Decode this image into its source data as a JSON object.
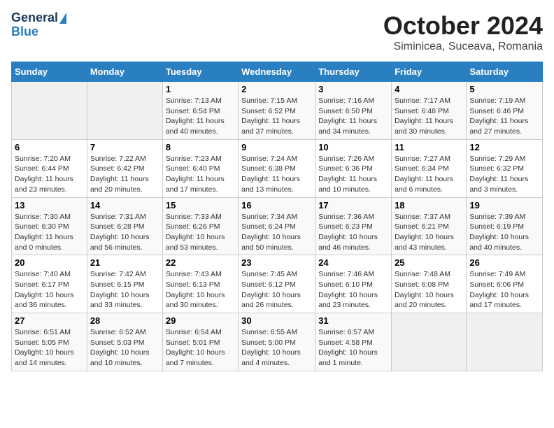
{
  "header": {
    "logo_general": "General",
    "logo_blue": "Blue",
    "month_title": "October 2024",
    "location": "Siminicea, Suceava, Romania"
  },
  "calendar": {
    "days_of_week": [
      "Sunday",
      "Monday",
      "Tuesday",
      "Wednesday",
      "Thursday",
      "Friday",
      "Saturday"
    ],
    "weeks": [
      [
        {
          "day": "",
          "info": ""
        },
        {
          "day": "",
          "info": ""
        },
        {
          "day": "1",
          "info": "Sunrise: 7:13 AM\nSunset: 6:54 PM\nDaylight: 11 hours and 40 minutes."
        },
        {
          "day": "2",
          "info": "Sunrise: 7:15 AM\nSunset: 6:52 PM\nDaylight: 11 hours and 37 minutes."
        },
        {
          "day": "3",
          "info": "Sunrise: 7:16 AM\nSunset: 6:50 PM\nDaylight: 11 hours and 34 minutes."
        },
        {
          "day": "4",
          "info": "Sunrise: 7:17 AM\nSunset: 6:48 PM\nDaylight: 11 hours and 30 minutes."
        },
        {
          "day": "5",
          "info": "Sunrise: 7:19 AM\nSunset: 6:46 PM\nDaylight: 11 hours and 27 minutes."
        }
      ],
      [
        {
          "day": "6",
          "info": "Sunrise: 7:20 AM\nSunset: 6:44 PM\nDaylight: 11 hours and 23 minutes."
        },
        {
          "day": "7",
          "info": "Sunrise: 7:22 AM\nSunset: 6:42 PM\nDaylight: 11 hours and 20 minutes."
        },
        {
          "day": "8",
          "info": "Sunrise: 7:23 AM\nSunset: 6:40 PM\nDaylight: 11 hours and 17 minutes."
        },
        {
          "day": "9",
          "info": "Sunrise: 7:24 AM\nSunset: 6:38 PM\nDaylight: 11 hours and 13 minutes."
        },
        {
          "day": "10",
          "info": "Sunrise: 7:26 AM\nSunset: 6:36 PM\nDaylight: 11 hours and 10 minutes."
        },
        {
          "day": "11",
          "info": "Sunrise: 7:27 AM\nSunset: 6:34 PM\nDaylight: 11 hours and 6 minutes."
        },
        {
          "day": "12",
          "info": "Sunrise: 7:29 AM\nSunset: 6:32 PM\nDaylight: 11 hours and 3 minutes."
        }
      ],
      [
        {
          "day": "13",
          "info": "Sunrise: 7:30 AM\nSunset: 6:30 PM\nDaylight: 11 hours and 0 minutes."
        },
        {
          "day": "14",
          "info": "Sunrise: 7:31 AM\nSunset: 6:28 PM\nDaylight: 10 hours and 56 minutes."
        },
        {
          "day": "15",
          "info": "Sunrise: 7:33 AM\nSunset: 6:26 PM\nDaylight: 10 hours and 53 minutes."
        },
        {
          "day": "16",
          "info": "Sunrise: 7:34 AM\nSunset: 6:24 PM\nDaylight: 10 hours and 50 minutes."
        },
        {
          "day": "17",
          "info": "Sunrise: 7:36 AM\nSunset: 6:23 PM\nDaylight: 10 hours and 46 minutes."
        },
        {
          "day": "18",
          "info": "Sunrise: 7:37 AM\nSunset: 6:21 PM\nDaylight: 10 hours and 43 minutes."
        },
        {
          "day": "19",
          "info": "Sunrise: 7:39 AM\nSunset: 6:19 PM\nDaylight: 10 hours and 40 minutes."
        }
      ],
      [
        {
          "day": "20",
          "info": "Sunrise: 7:40 AM\nSunset: 6:17 PM\nDaylight: 10 hours and 36 minutes."
        },
        {
          "day": "21",
          "info": "Sunrise: 7:42 AM\nSunset: 6:15 PM\nDaylight: 10 hours and 33 minutes."
        },
        {
          "day": "22",
          "info": "Sunrise: 7:43 AM\nSunset: 6:13 PM\nDaylight: 10 hours and 30 minutes."
        },
        {
          "day": "23",
          "info": "Sunrise: 7:45 AM\nSunset: 6:12 PM\nDaylight: 10 hours and 26 minutes."
        },
        {
          "day": "24",
          "info": "Sunrise: 7:46 AM\nSunset: 6:10 PM\nDaylight: 10 hours and 23 minutes."
        },
        {
          "day": "25",
          "info": "Sunrise: 7:48 AM\nSunset: 6:08 PM\nDaylight: 10 hours and 20 minutes."
        },
        {
          "day": "26",
          "info": "Sunrise: 7:49 AM\nSunset: 6:06 PM\nDaylight: 10 hours and 17 minutes."
        }
      ],
      [
        {
          "day": "27",
          "info": "Sunrise: 6:51 AM\nSunset: 5:05 PM\nDaylight: 10 hours and 14 minutes."
        },
        {
          "day": "28",
          "info": "Sunrise: 6:52 AM\nSunset: 5:03 PM\nDaylight: 10 hours and 10 minutes."
        },
        {
          "day": "29",
          "info": "Sunrise: 6:54 AM\nSunset: 5:01 PM\nDaylight: 10 hours and 7 minutes."
        },
        {
          "day": "30",
          "info": "Sunrise: 6:55 AM\nSunset: 5:00 PM\nDaylight: 10 hours and 4 minutes."
        },
        {
          "day": "31",
          "info": "Sunrise: 6:57 AM\nSunset: 4:58 PM\nDaylight: 10 hours and 1 minute."
        },
        {
          "day": "",
          "info": ""
        },
        {
          "day": "",
          "info": ""
        }
      ]
    ]
  }
}
